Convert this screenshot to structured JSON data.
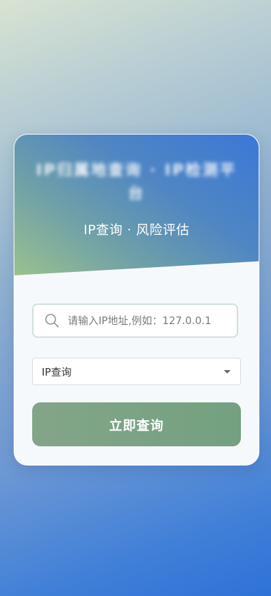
{
  "header": {
    "title": "IP归属地查询 · IP检测平台",
    "subtitle": "IP查询 · 风险评估"
  },
  "search": {
    "icon": "search-icon",
    "placeholder": "请输入IP地址,例如：127.0.0.1",
    "value": ""
  },
  "query_type": {
    "selected": "IP查询",
    "icon": "chevron-down-icon"
  },
  "submit": {
    "label": "立即查询"
  },
  "colors": {
    "button": "#7aa384",
    "header_start": "#9ac18e",
    "header_end": "#3b78d6",
    "background_end": "#2f72d7"
  }
}
